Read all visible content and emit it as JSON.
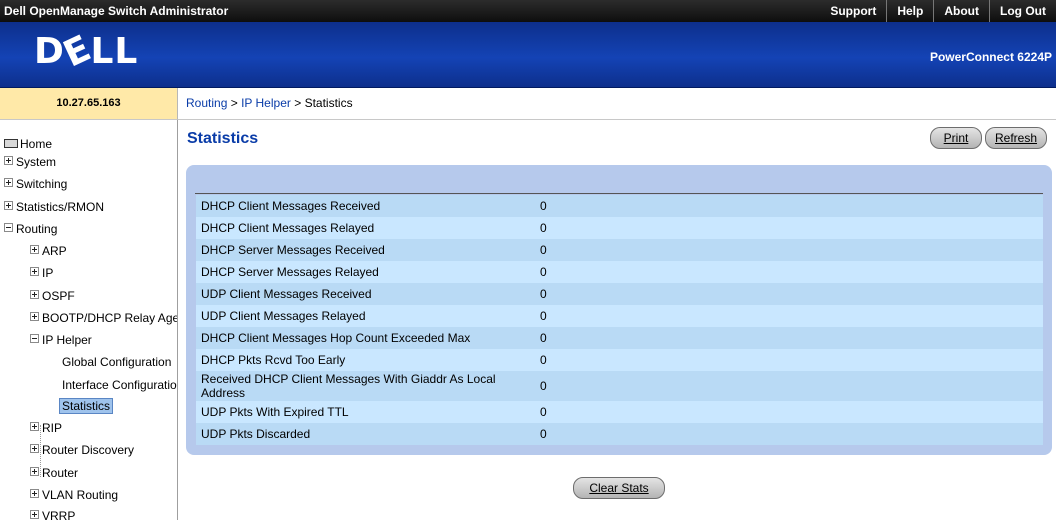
{
  "app": {
    "title": "Dell OpenManage Switch Administrator",
    "nav": [
      "Support",
      "Help",
      "About",
      "Log Out"
    ],
    "logo": "DELL",
    "model": "PowerConnect 6224P",
    "ip": "10.27.65.163"
  },
  "breadcrumb": {
    "routing": "Routing",
    "sep1": " > ",
    "ip_helper": "IP Helper",
    "sep2": " > ",
    "current": "Statistics"
  },
  "tree": {
    "home": "Home",
    "system": "System",
    "switching": "Switching",
    "stats_rmon": "Statistics/RMON",
    "routing": "Routing",
    "arp": "ARP",
    "ip": "IP",
    "ospf": "OSPF",
    "bootp": "BOOTP/DHCP Relay Agent",
    "ip_helper": "IP Helper",
    "global_config": "Global Configuration",
    "interface_config": "Interface Configuration",
    "statistics": "Statistics",
    "rip": "RIP",
    "router_discovery": "Router Discovery",
    "router": "Router",
    "vlan_routing": "VLAN Routing",
    "vrrp": "VRRP"
  },
  "page": {
    "title": "Statistics",
    "print_label": "Print",
    "refresh_label": "Refresh",
    "clear_label": "Clear Stats"
  },
  "stats": [
    {
      "label": "DHCP Client Messages Received",
      "value": "0"
    },
    {
      "label": "DHCP Client Messages Relayed",
      "value": "0"
    },
    {
      "label": "DHCP Server Messages Received",
      "value": "0"
    },
    {
      "label": "DHCP Server Messages Relayed",
      "value": "0"
    },
    {
      "label": "UDP Client Messages Received",
      "value": "0"
    },
    {
      "label": "UDP Client Messages Relayed",
      "value": "0"
    },
    {
      "label": "DHCP Client Messages Hop Count Exceeded Max",
      "value": "0"
    },
    {
      "label": "DHCP Pkts Rcvd Too Early",
      "value": "0"
    },
    {
      "label": "Received DHCP Client Messages With Giaddr As Local Address",
      "value": "0"
    },
    {
      "label": "UDP Pkts With Expired TTL",
      "value": "0"
    },
    {
      "label": "UDP Pkts Discarded",
      "value": "0"
    }
  ],
  "colors": {
    "banner": "#1443b5",
    "link": "#0a3ca8",
    "panel": "#b6c9ec",
    "row_odd": "#b9daf5",
    "row_even": "#c9e7ff",
    "ip_box": "#ffe9a8"
  }
}
